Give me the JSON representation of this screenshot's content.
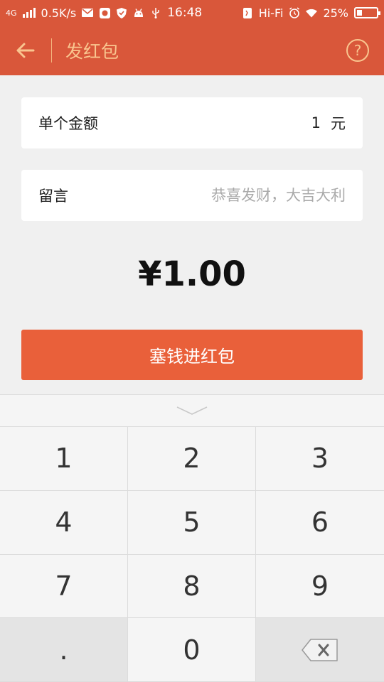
{
  "status_bar": {
    "network": "4G",
    "speed": "0.5K/s",
    "time": "16:48",
    "wifi_label": "Hi-Fi",
    "battery": "25%",
    "battery_fraction": 0.25
  },
  "header": {
    "title": "发红包",
    "help": "?"
  },
  "amount_card": {
    "label": "单个金额",
    "value": "1",
    "unit": "元"
  },
  "message_card": {
    "label": "留言",
    "placeholder": "恭喜发财，大吉大利"
  },
  "total": "¥1.00",
  "submit_label": "塞钱进红包",
  "keyboard": {
    "keys": [
      "1",
      "2",
      "3",
      "4",
      "5",
      "6",
      "7",
      "8",
      "9",
      ".",
      "0"
    ]
  },
  "colors": {
    "header": "#d9573a",
    "accent": "#e9603a",
    "header_text": "#f9c58f"
  }
}
